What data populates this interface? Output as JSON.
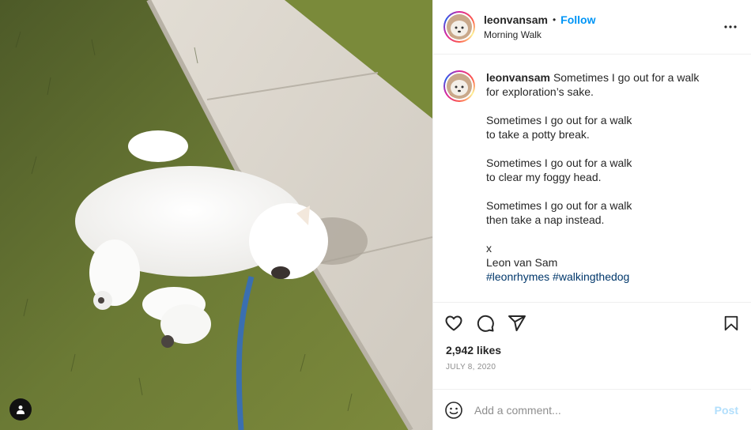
{
  "post": {
    "username": "leonvansam",
    "separator": "•",
    "follow_label": "Follow",
    "location": "Morning Walk",
    "more_icon": "more-options-icon"
  },
  "caption": {
    "username": "leonvansam",
    "text": "Sometimes I go out for a walk\nfor exploration’s sake.\n\nSometimes I go out for a walk\nto take a potty break.\n\nSometimes I go out for a walk\nto clear my foggy head.\n\nSometimes I go out for a walk\nthen take a nap instead.\n\nx\nLeon van Sam\n",
    "hashtags": [
      "#leonrhymes",
      "#walkingthedog"
    ]
  },
  "actions": {
    "icons": [
      "heart-icon",
      "comment-icon",
      "share-icon",
      "bookmark-icon"
    ],
    "likes": "2,942 likes",
    "date": "JULY 8, 2020"
  },
  "comment_box": {
    "placeholder": "Add a comment...",
    "post_label": "Post",
    "emoji_icon": "emoji-icon"
  },
  "colors": {
    "follow": "#0095f6",
    "hashtag": "#00376b",
    "post_disabled": "#b2dffc",
    "border": "#efefef",
    "muted": "#8e8e8e"
  }
}
